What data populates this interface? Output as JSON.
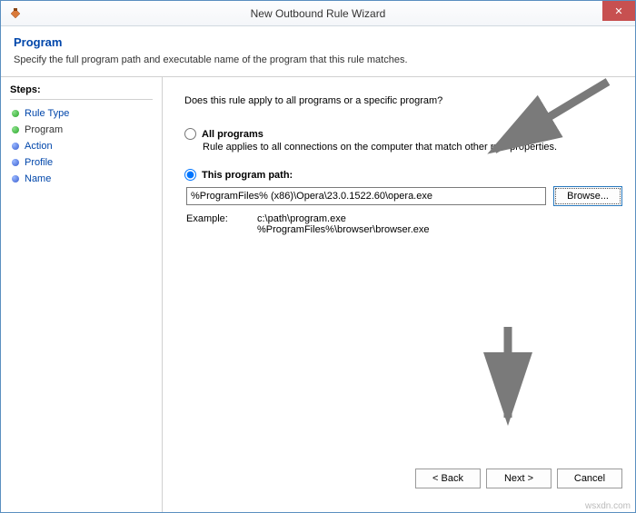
{
  "window": {
    "title": "New Outbound Rule Wizard"
  },
  "header": {
    "title": "Program",
    "subtitle": "Specify the full program path and executable name of the program that this rule matches."
  },
  "sidebar": {
    "title": "Steps:",
    "items": [
      {
        "label": "Rule Type",
        "bullet": "green",
        "link": true
      },
      {
        "label": "Program",
        "bullet": "green",
        "link": false
      },
      {
        "label": "Action",
        "bullet": "blue",
        "link": true
      },
      {
        "label": "Profile",
        "bullet": "blue",
        "link": true
      },
      {
        "label": "Name",
        "bullet": "blue",
        "link": true
      }
    ]
  },
  "content": {
    "prompt": "Does this rule apply to all programs or a specific program?",
    "option_all": {
      "label": "All programs",
      "desc": "Rule applies to all connections on the computer that match other rule properties."
    },
    "option_path": {
      "label": "This program path:",
      "value": "%ProgramFiles% (x86)\\Opera\\23.0.1522.60\\opera.exe",
      "browse": "Browse..."
    },
    "example": {
      "label": "Example:",
      "line1": "c:\\path\\program.exe",
      "line2": "%ProgramFiles%\\browser\\browser.exe"
    }
  },
  "footer": {
    "back": "< Back",
    "next": "Next >",
    "cancel": "Cancel"
  },
  "watermark": "wsxdn.com"
}
